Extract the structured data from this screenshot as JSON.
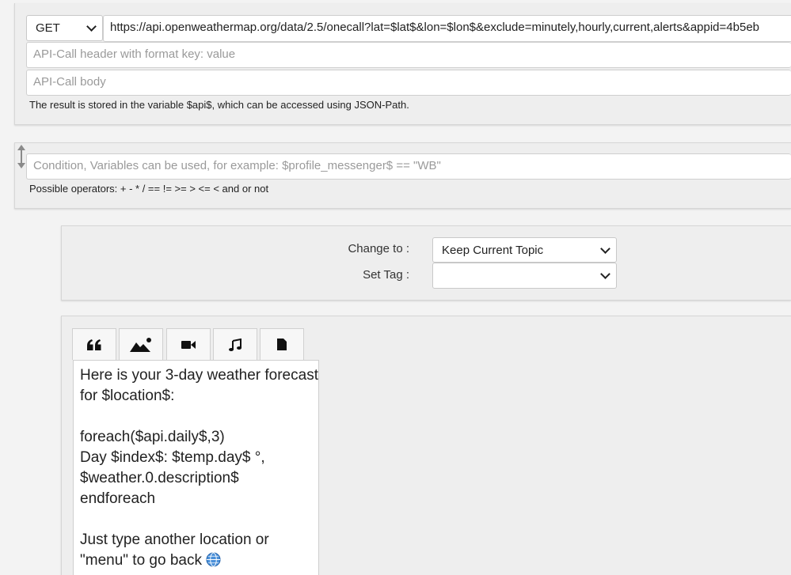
{
  "api_call": {
    "method": "GET",
    "url": "https://api.openweathermap.org/data/2.5/onecall?lat=$lat$&lon=$lon$&exclude=minutely,hourly,current,alerts&appid=4b5eb",
    "header_placeholder": "API-Call header with format key: value",
    "body_placeholder": "API-Call body",
    "note": "The result is stored in the variable $api$, which can be accessed using JSON-Path."
  },
  "condition": {
    "placeholder": "Condition, Variables can be used, for example: $profile_messenger$ == \"WB\"",
    "operators_note": "Possible operators: + - * / == != >= > <= < and or not"
  },
  "topic": {
    "change_to_label": "Change to :",
    "change_to_value": "Keep Current Topic",
    "set_tag_label": "Set Tag :",
    "set_tag_value": ""
  },
  "message": {
    "tabs": [
      {
        "icon": "quote-icon"
      },
      {
        "icon": "image-icon"
      },
      {
        "icon": "video-icon"
      },
      {
        "icon": "music-icon"
      },
      {
        "icon": "file-icon"
      }
    ],
    "lines": [
      "Here is your 3-day weather forecast",
      "for $location$:",
      "",
      "foreach($api.daily$,3)",
      "Day $index$: $temp.day$ °,",
      "$weather.0.description$",
      "endforeach",
      "",
      "Just type another location or",
      "\"menu\" to go back"
    ]
  }
}
